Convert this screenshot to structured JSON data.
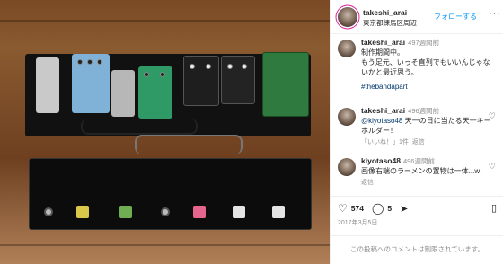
{
  "post": {
    "username": "takeshi_arai",
    "location": "東京都練馬区周辺",
    "follow_label": "フォローする",
    "more_icon": "ellipsis-icon"
  },
  "caption": {
    "username": "takeshi_arai",
    "time_ago": "497週間前",
    "lines": [
      "制作期間中。",
      "もう足元、いっそ直列でもいいんじゃないかと最近思う。"
    ],
    "hashtag": "#thebandapart"
  },
  "comments": [
    {
      "username": "takeshi_arai",
      "time_ago": "496週間前",
      "mention": "@kiyotaso48",
      "text": " 天一の日に当たる天一キーホルダー！",
      "likes": "「いいね！」1件",
      "reply": "返信"
    },
    {
      "username": "kiyotaso48",
      "time_ago": "496週間前",
      "text": "画像右端のラーメンの置物は一体...w",
      "reply": "返信"
    }
  ],
  "actions": {
    "likes_count": "574",
    "comments_count": "5"
  },
  "date": "2017年3月5日",
  "comments_closed": "この投稿へのコメントは制限されています。",
  "colors": {
    "link_blue": "#0095f6",
    "secondary_gray": "#8e8e8e",
    "text": "#262626"
  }
}
